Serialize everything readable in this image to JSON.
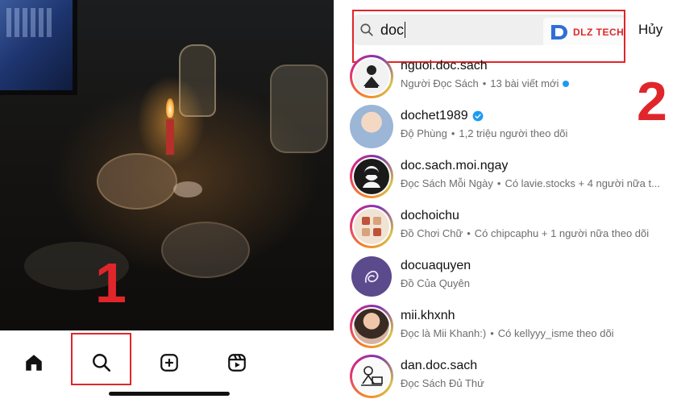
{
  "left_panel": {
    "step_number": "1",
    "tabbar": [
      {
        "icon": "home-icon"
      },
      {
        "icon": "search-icon"
      },
      {
        "icon": "create-icon"
      },
      {
        "icon": "reels-icon"
      }
    ]
  },
  "right_panel": {
    "step_number": "2",
    "search": {
      "query": "doc",
      "icon": "search-icon"
    },
    "cancel_label": "Hủy",
    "watermark": {
      "text": "DLZ TECH"
    },
    "results": [
      {
        "username": "nguoi.doc.sach",
        "verified": false,
        "subtitle": "Người Đọc Sách",
        "detail": "13 bài viết mới",
        "new_dot": true,
        "ring": true
      },
      {
        "username": "dochet1989",
        "verified": true,
        "subtitle": "Độ Phùng",
        "detail": "1,2 triệu người theo dõi",
        "new_dot": false,
        "ring": false
      },
      {
        "username": "doc.sach.moi.ngay",
        "verified": false,
        "subtitle": "Đọc Sách Mỗi Ngày",
        "detail": "Có lavie.stocks + 4 người nữa t...",
        "new_dot": false,
        "ring": true
      },
      {
        "username": "dochoichu",
        "verified": false,
        "subtitle": "Đồ Chơi Chữ",
        "detail": "Có chipcaphu + 1 người nữa theo dõi",
        "new_dot": false,
        "ring": true
      },
      {
        "username": "docuaquyen",
        "verified": false,
        "subtitle": "Đồ Của Quyên",
        "detail": "",
        "new_dot": false,
        "ring": false
      },
      {
        "username": "mii.khxnh",
        "verified": false,
        "subtitle": "Đọc là Mii Khanh:)",
        "detail": "Có kellyyy_isme theo dõi",
        "new_dot": false,
        "ring": true
      },
      {
        "username": "dan.doc.sach",
        "verified": false,
        "subtitle": "Đọc Sách Đủ Thứ",
        "detail": "",
        "new_dot": false,
        "ring": true
      }
    ]
  },
  "colors": {
    "accent_red": "#e0262a",
    "verified_blue": "#1d9bf0",
    "search_bg": "#efefef",
    "text_secondary": "#6d6d6d"
  }
}
